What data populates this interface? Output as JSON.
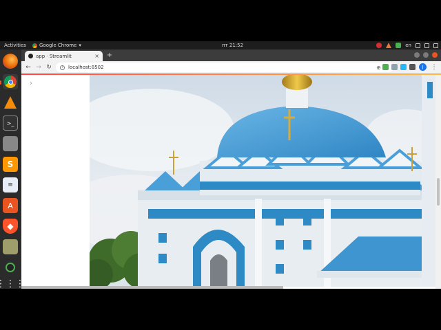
{
  "os": {
    "activities": "Activities",
    "app_menu": "Google Chrome",
    "clock": "пт 21:52",
    "language": "en"
  },
  "browser": {
    "tab_title": "app · Streamlit",
    "url": "localhost:8502",
    "profile_initial": "J"
  },
  "page": {
    "hero_image": "church-photo"
  },
  "colors": {
    "dome": "#4a9fd8",
    "sky": "#dfe7ef",
    "accent": "#ff4b4b"
  }
}
